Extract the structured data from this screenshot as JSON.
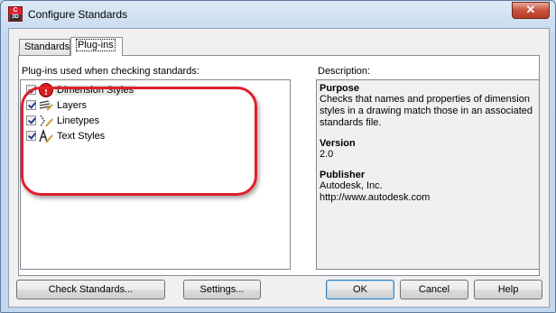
{
  "window": {
    "title": "Configure Standards",
    "close_glyph": "✕"
  },
  "app_icon": {
    "line1": "C",
    "line2": "3D"
  },
  "tabs": [
    {
      "label": "Standards",
      "active": false
    },
    {
      "label": "Plug-ins",
      "active": true
    }
  ],
  "plugins_label": "Plug-ins used when checking standards:",
  "plugins": [
    {
      "label": "Dimension Styles",
      "checked": true,
      "icon": "error-icon",
      "selected": true
    },
    {
      "label": "Layers",
      "checked": true,
      "icon": "layers-icon",
      "selected": false
    },
    {
      "label": "Linetypes",
      "checked": true,
      "icon": "linetypes-icon",
      "selected": false
    },
    {
      "label": "Text Styles",
      "checked": true,
      "icon": "text-styles-icon",
      "selected": false
    }
  ],
  "description": {
    "label": "Description:",
    "purpose_heading": "Purpose",
    "purpose_text": "Checks that names and properties of dimension styles in a drawing match those in an associated standards file.",
    "version_heading": "Version",
    "version_text": "2.0",
    "publisher_heading": "Publisher",
    "publisher_name": "Autodesk, Inc.",
    "publisher_url": "http://www.autodesk.com"
  },
  "buttons": {
    "check_standards": "Check Standards...",
    "settings": "Settings...",
    "ok": "OK",
    "cancel": "Cancel",
    "help": "Help"
  },
  "colors": {
    "highlight": "#e0202a",
    "error_icon": "#d42020"
  }
}
